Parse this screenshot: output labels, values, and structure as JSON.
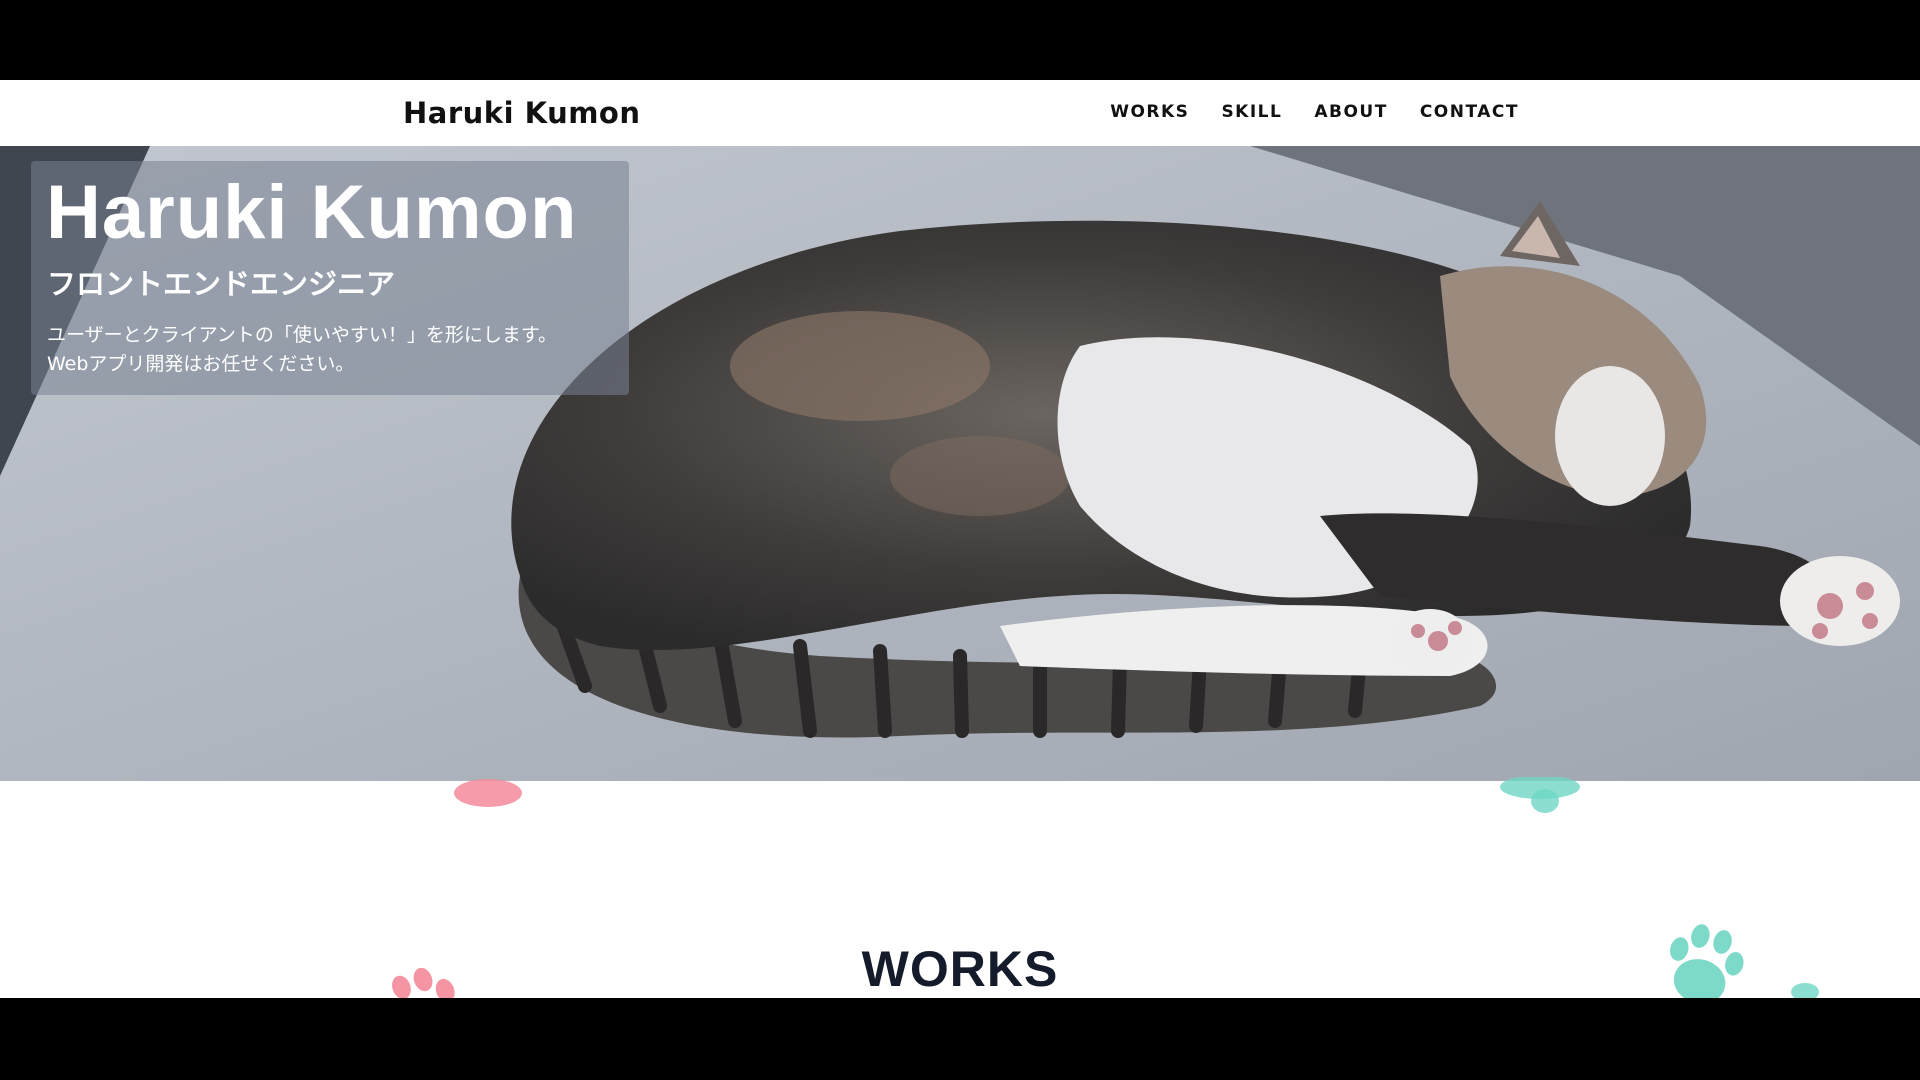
{
  "header": {
    "logo": "Haruki Kumon",
    "nav": [
      {
        "label": "WORKS"
      },
      {
        "label": "SKILL"
      },
      {
        "label": "ABOUT"
      },
      {
        "label": "CONTACT"
      }
    ]
  },
  "hero": {
    "title": "Haruki Kumon",
    "role": "フロントエンドエンジニア",
    "description_lines": [
      "ユーザーとクライアントの「使いやすい！」を形にします。",
      "Webアプリ開発はお任せください。"
    ]
  },
  "works": {
    "heading": "WORKS"
  },
  "colors": {
    "paw_pink": "#f48a9a",
    "paw_teal": "#6fd7c4",
    "heading": "#141b2b"
  }
}
